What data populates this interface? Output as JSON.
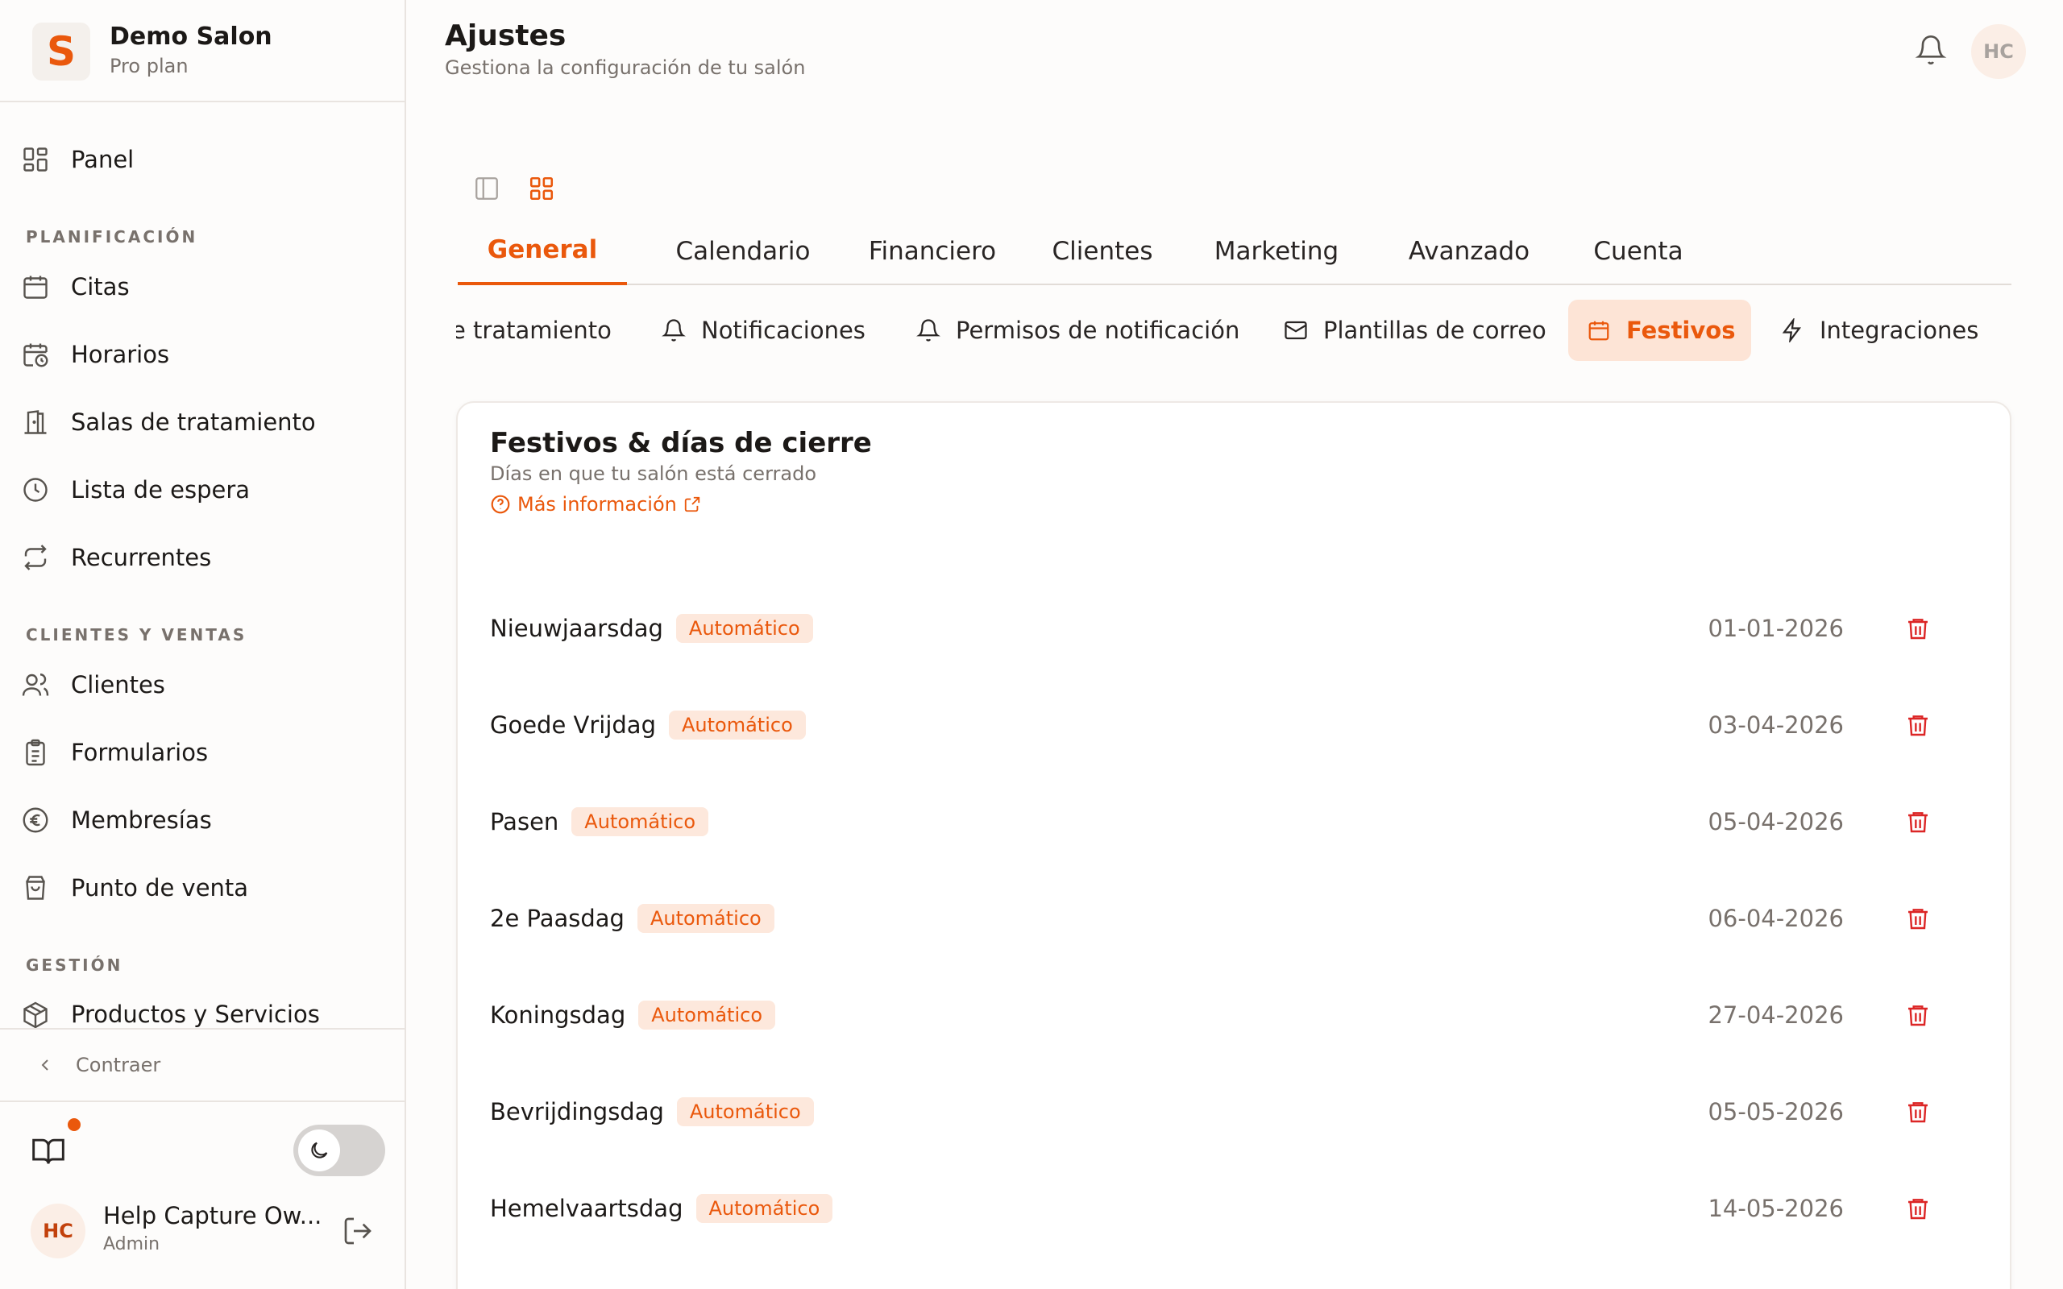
{
  "brand": {
    "name": "Demo Salon",
    "plan": "Pro plan",
    "logo_letter": "S",
    "accent": "#ea580c"
  },
  "sidebar": {
    "panel": "Panel",
    "sections": [
      {
        "title": "PLANIFICACIÓN",
        "items": [
          {
            "label": "Citas",
            "icon": "calendar-icon"
          },
          {
            "label": "Horarios",
            "icon": "calendar-clock-icon"
          },
          {
            "label": "Salas de tratamiento",
            "icon": "door-icon"
          },
          {
            "label": "Lista de espera",
            "icon": "clock-icon"
          },
          {
            "label": "Recurrentes",
            "icon": "repeat-icon"
          }
        ]
      },
      {
        "title": "CLIENTES Y VENTAS",
        "items": [
          {
            "label": "Clientes",
            "icon": "users-icon"
          },
          {
            "label": "Formularios",
            "icon": "clipboard-icon"
          },
          {
            "label": "Membresías",
            "icon": "euro-icon"
          },
          {
            "label": "Punto de venta",
            "icon": "shopping-bag-icon"
          }
        ]
      },
      {
        "title": "GESTIÓN",
        "items": [
          {
            "label": "Productos y Servicios",
            "icon": "package-icon"
          }
        ]
      }
    ],
    "collapse": "Contraer",
    "user": {
      "initials": "HC",
      "name": "Help Capture Ow...",
      "role": "Admin"
    }
  },
  "header": {
    "title": "Ajustes",
    "subtitle": "Gestiona la configuración de tu salón",
    "avatar": "HC"
  },
  "tabs": [
    "General",
    "Calendario",
    "Financiero",
    "Clientes",
    "Marketing",
    "Avanzado",
    "Cuenta"
  ],
  "active_tab": "General",
  "subtabs": [
    {
      "label": "e tratamiento",
      "icon": ""
    },
    {
      "label": "Notificaciones",
      "icon": "bell-icon"
    },
    {
      "label": "Permisos de notificación",
      "icon": "bell-icon"
    },
    {
      "label": "Plantillas de correo",
      "icon": "mail-icon"
    },
    {
      "label": "Festivos",
      "icon": "calendar-icon"
    },
    {
      "label": "Integraciones",
      "icon": "zap-icon"
    }
  ],
  "active_subtab": "Festivos",
  "card": {
    "title": "Festivos & días de cierre",
    "subtitle": "Días en que tu salón está cerrado",
    "more": "Más información",
    "holidays": [
      {
        "name": "Nieuwjaarsdag",
        "badge": "Automático",
        "date": "01-01-2026"
      },
      {
        "name": "Goede Vrijdag",
        "badge": "Automático",
        "date": "03-04-2026"
      },
      {
        "name": "Pasen",
        "badge": "Automático",
        "date": "05-04-2026"
      },
      {
        "name": "2e Paasdag",
        "badge": "Automático",
        "date": "06-04-2026"
      },
      {
        "name": "Koningsdag",
        "badge": "Automático",
        "date": "27-04-2026"
      },
      {
        "name": "Bevrijdingsdag",
        "badge": "Automático",
        "date": "05-05-2026"
      },
      {
        "name": "Hemelvaartsdag",
        "badge": "Automático",
        "date": "14-05-2026"
      }
    ]
  }
}
